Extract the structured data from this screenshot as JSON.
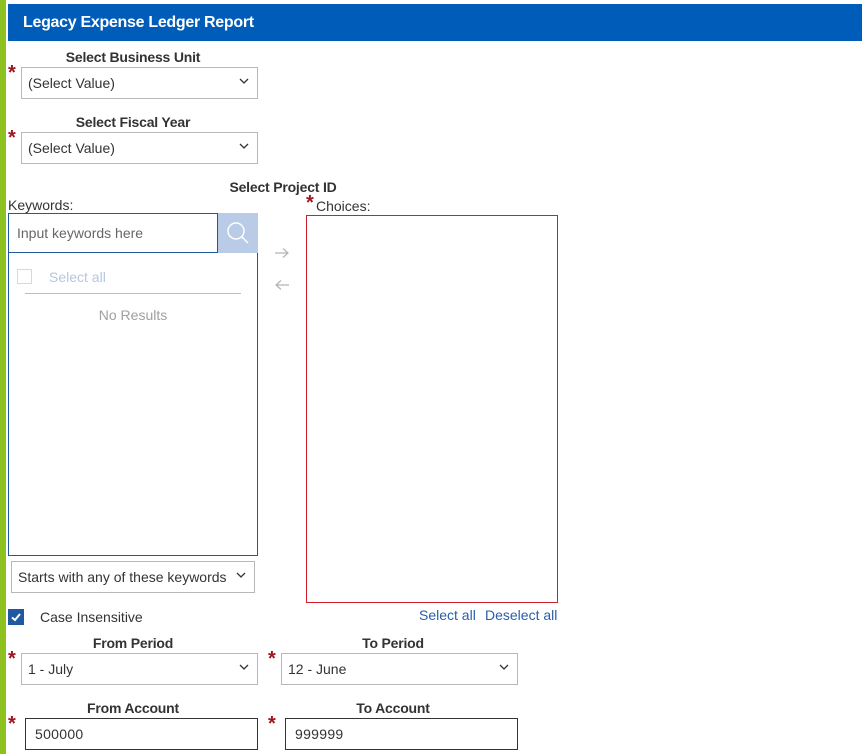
{
  "header": {
    "title": "Legacy Expense Ledger Report"
  },
  "business_unit": {
    "label": "Select Business Unit",
    "value": "(Select Value)",
    "required": true
  },
  "fiscal_year": {
    "label": "Select Fiscal Year",
    "value": "(Select Value)",
    "required": true
  },
  "project_id": {
    "label": "Select Project ID",
    "keywords_label": "Keywords:",
    "keywords_placeholder": "Input keywords here",
    "select_all_label": "Select all",
    "no_results": "No Results",
    "choices_label": "Choices:",
    "choices_required": true,
    "choices": [],
    "links": {
      "select_all": "Select all",
      "deselect_all": "Deselect all"
    },
    "match_mode": "Starts with any of these keywords",
    "case_insensitive": {
      "label": "Case Insensitive",
      "checked": true
    }
  },
  "from_period": {
    "label": "From Period",
    "value": "1 - July",
    "required": true
  },
  "to_period": {
    "label": "To Period",
    "value": "12 - June",
    "required": true
  },
  "from_account": {
    "label": "From Account",
    "value": "500000",
    "required": true
  },
  "to_account": {
    "label": "To Account",
    "value": "999999",
    "required": true
  },
  "icons": {
    "search": "search-icon",
    "chevron": "chevron-down-icon",
    "move_right": "arrow-right-icon",
    "move_left": "arrow-left-icon",
    "check": "checkmark-icon",
    "required": "asterisk-icon"
  },
  "colors": {
    "header_bg": "#005cb9",
    "accent_stripe": "#8cc11f",
    "required": "#a0141e",
    "error_border": "#d0202c",
    "link": "#2a5ea8",
    "search_button": "#b9cbe6"
  }
}
